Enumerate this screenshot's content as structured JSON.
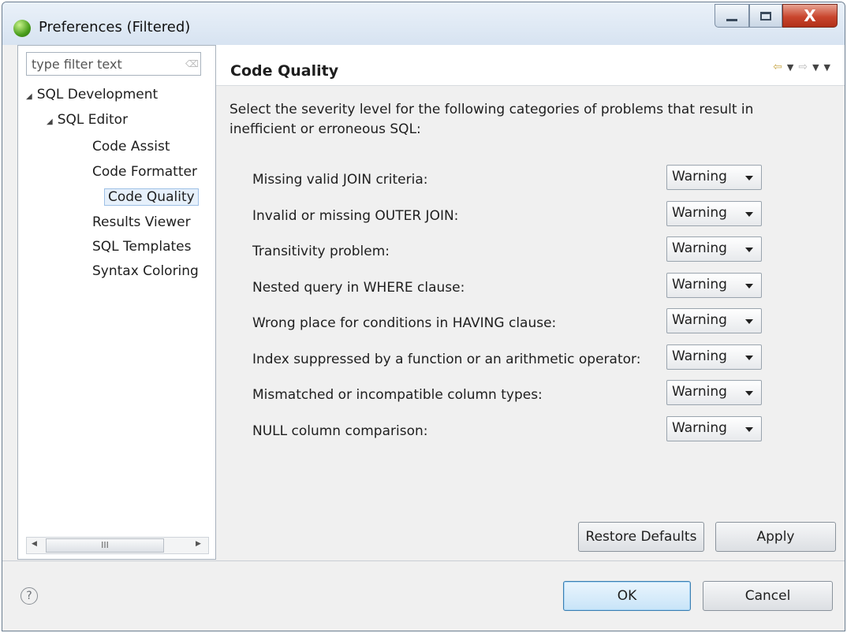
{
  "window": {
    "title": "Preferences (Filtered)",
    "close_glyph": "X"
  },
  "sidebar": {
    "filter_placeholder": "type filter text",
    "tree": [
      {
        "label": "SQL Development"
      },
      {
        "label": "SQL Editor"
      },
      {
        "label": "Code Assist"
      },
      {
        "label": "Code Formatter"
      },
      {
        "label": "Code Quality",
        "selected": true
      },
      {
        "label": "Results Viewer"
      },
      {
        "label": "SQL Templates"
      },
      {
        "label": "Syntax Coloring"
      }
    ],
    "scroll_thumb_glyph": "III"
  },
  "main": {
    "title": "Code Quality",
    "description": "Select the severity level for the following categories of problems that result in inefficient or erroneous SQL:",
    "rows": [
      {
        "label": "Missing valid JOIN criteria:",
        "value": "Warning"
      },
      {
        "label": "Invalid or missing OUTER JOIN:",
        "value": "Warning"
      },
      {
        "label": "Transitivity problem:",
        "value": "Warning"
      },
      {
        "label": "Nested query in WHERE clause:",
        "value": "Warning"
      },
      {
        "label": "Wrong place for conditions in HAVING clause:",
        "value": "Warning"
      },
      {
        "label": "Index suppressed by a function or an arithmetic operator:",
        "value": "Warning"
      },
      {
        "label": "Mismatched or incompatible column types:",
        "value": "Warning"
      },
      {
        "label": "NULL column comparison:",
        "value": "Warning"
      }
    ],
    "restore_defaults_label": "Restore Defaults",
    "apply_label": "Apply"
  },
  "footer": {
    "help_glyph": "?",
    "ok_label": "OK",
    "cancel_label": "Cancel"
  },
  "colors": {
    "close_button": "#c9462e",
    "selection_border": "#9ec0e6",
    "ok_border": "#3c7fb1"
  }
}
